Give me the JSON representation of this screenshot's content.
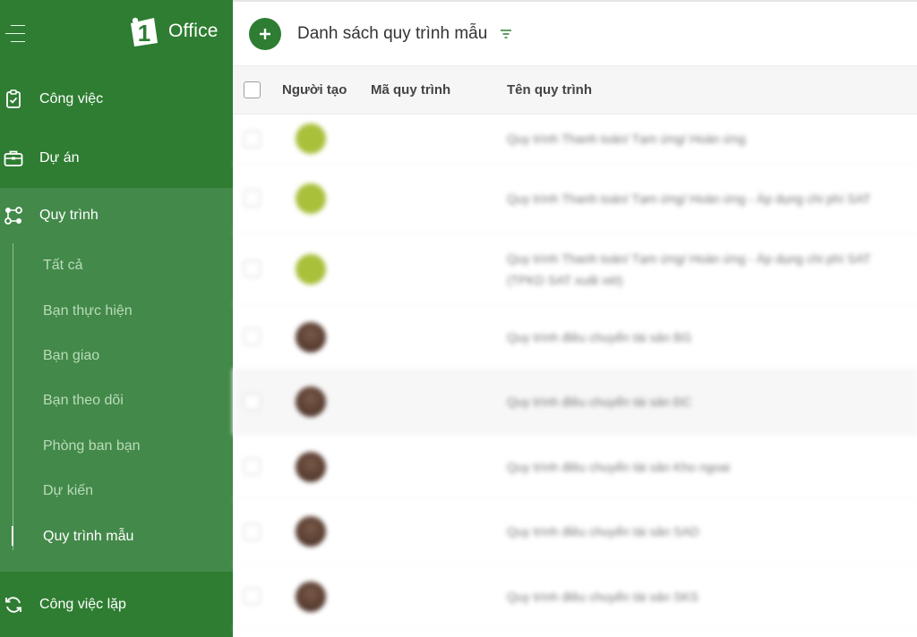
{
  "app": {
    "logo_text": "Office",
    "logo_mark_text": "1"
  },
  "colors": {
    "sidebar": "#2e7d32",
    "sidebar_group": "#43894a",
    "accent": "#2e7d32",
    "header_bg": "#f6f6f6"
  },
  "sidebar": {
    "items": [
      {
        "label": "Công việc",
        "icon": "clipboard-check-icon"
      },
      {
        "label": "Dự án",
        "icon": "briefcase-icon"
      },
      {
        "label": "Quy trình",
        "icon": "workflow-icon"
      },
      {
        "label": "Công việc lặp",
        "icon": "repeat-icon"
      }
    ],
    "sub_items": [
      {
        "label": "Tất cả"
      },
      {
        "label": "Bạn thực hiện"
      },
      {
        "label": "Bạn giao"
      },
      {
        "label": "Bạn theo dõi"
      },
      {
        "label": "Phòng ban bạn"
      },
      {
        "label": "Dự kiến"
      },
      {
        "label": "Quy trình mẫu",
        "active": true
      }
    ]
  },
  "toolbar": {
    "title": "Danh sách quy trình mẫu",
    "add_icon": "plus-icon",
    "filter_icon": "filter-icon"
  },
  "table": {
    "columns": [
      "Người tạo",
      "Mã quy trình",
      "Tên quy trình"
    ],
    "rows": [
      {
        "avatar": "green",
        "code": "",
        "name": "Quy trình Thanh toán/ Tạm ứng/ Hoàn ứng"
      },
      {
        "avatar": "green",
        "code": "",
        "name": "Quy trình Thanh toán/ Tạm ứng/ Hoàn ứng - Áp dụng chi phí SAT"
      },
      {
        "avatar": "green",
        "code": "",
        "name": "Quy trình Thanh toán/ Tạm ứng/ Hoàn ứng - Áp dụng chi phí SAT (TPKD SAT xuất xét)"
      },
      {
        "avatar": "brown",
        "code": "",
        "name": "Quy trình điều chuyển tài sản BG"
      },
      {
        "avatar": "brown",
        "code": "",
        "name": "Quy trình điều chuyển tài sản ĐC"
      },
      {
        "avatar": "brown",
        "code": "",
        "name": "Quy trình điều chuyển tài sản Kho ngoai"
      },
      {
        "avatar": "brown",
        "code": "",
        "name": "Quy trình điều chuyển tài sản SAD"
      },
      {
        "avatar": "brown",
        "code": "",
        "name": "Quy trình điều chuyển tài sản SKS"
      }
    ]
  }
}
